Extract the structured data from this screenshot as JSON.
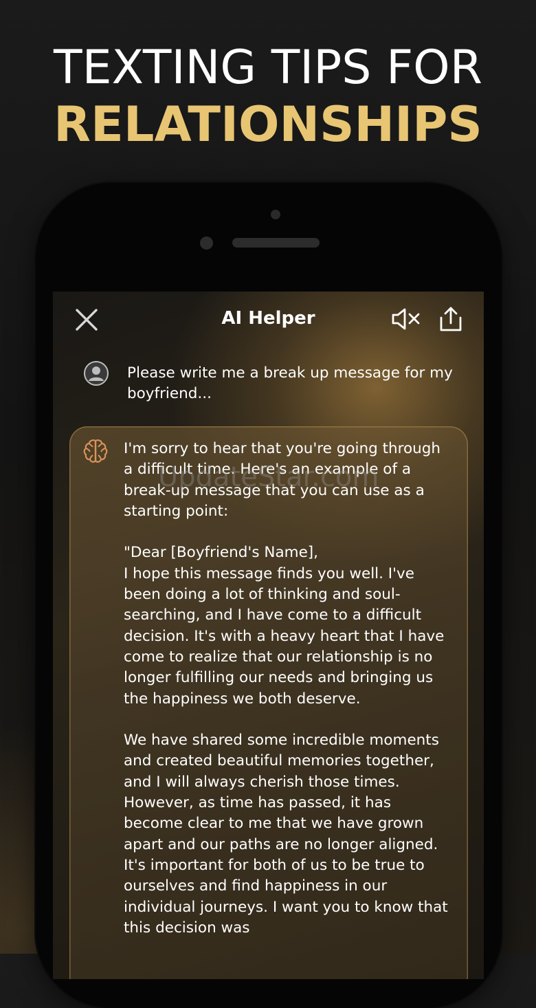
{
  "headline": {
    "line1": "TEXTING TIPS FOR",
    "line2": "RELATIONSHIPS"
  },
  "topbar": {
    "title": "AI Helper"
  },
  "user_message": {
    "text": "Please write me a break up message for my boyfriend..."
  },
  "ai_message": {
    "intro": "I'm sorry to hear that you're going through a difficult time. Here's an example of a break-up message that you can use as a starting point:",
    "salutation": "\"Dear [Boyfriend's Name],",
    "paragraph1": "I hope this message finds you well. I've been doing a lot of thinking and soul-searching, and I have come to a difficult decision. It's with a heavy heart that I have come to realize that our relationship is no longer fulfilling our needs and bringing us the happiness we both deserve.",
    "paragraph2": "We have shared some incredible moments and created beautiful memories together, and I will always cherish those times. However, as time has passed, it has become clear to me that we have grown apart and our paths are no longer aligned. It's important for both of us to be true to ourselves and find happiness in our individual journeys. I want you to know that this decision was"
  },
  "watermark": {
    "text": "UpdateStar.com"
  },
  "colors": {
    "accent_gold": "#e8c573",
    "brain_icon": "#d9935a",
    "background": "#161616"
  },
  "icons": {
    "close": "close-icon",
    "mute": "speaker-mute-icon",
    "share": "share-icon",
    "avatar": "user-avatar-icon",
    "ai": "brain-icon"
  }
}
